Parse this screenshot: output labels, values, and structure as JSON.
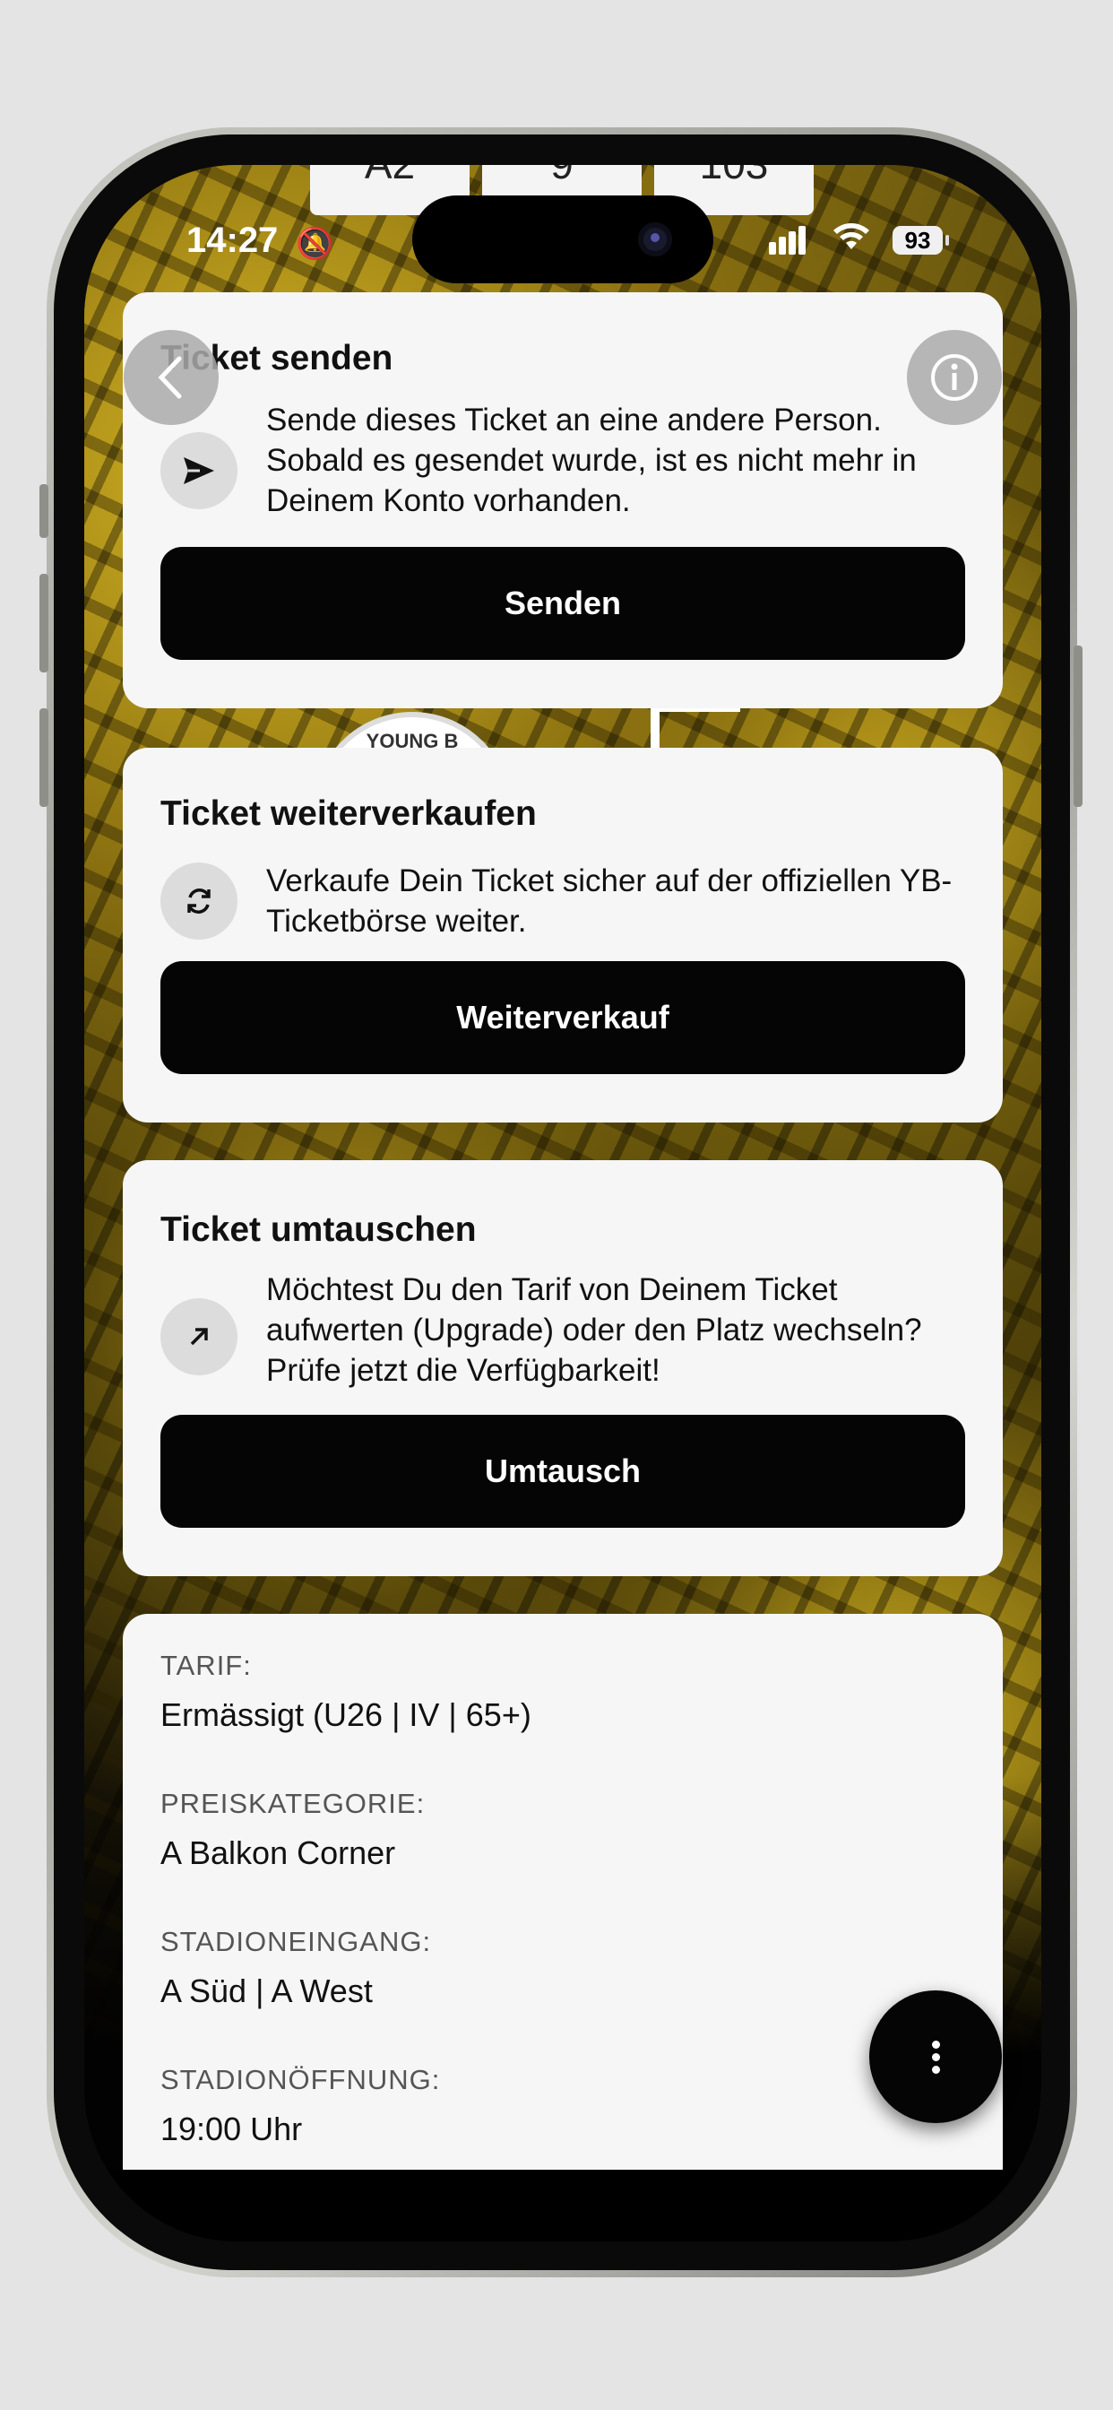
{
  "status_bar": {
    "time": "14:27",
    "battery": "93"
  },
  "seat_tabs": [
    "A2",
    "9",
    "103"
  ],
  "send_card": {
    "title": "Ticket senden",
    "description": "Sende dieses Ticket an eine andere Person. Sobald es gesendet wurde, ist es nicht mehr in Deinem Konto vorhanden.",
    "button": "Senden",
    "icon": "send-icon"
  },
  "resell_card": {
    "title": "Ticket weiterverkaufen",
    "description": "Verkaufe Dein Ticket sicher auf der offiziellen YB-Ticketbörse weiter.",
    "button": "Weiterverkauf",
    "icon": "refresh-icon"
  },
  "exchange_card": {
    "title": "Ticket umtauschen",
    "description": "Möchtest Du den Tarif von Deinem Ticket aufwerten (Upgrade) oder den Platz wechseln? Prüfe jetzt die Verfügbarkeit!",
    "button": "Umtausch",
    "icon": "arrow-up-right-icon"
  },
  "logo_peek": "YOUNG B",
  "details": [
    {
      "label": "TARIF:",
      "value": "Ermässigt (U26 | IV | 65+)"
    },
    {
      "label": "PREISKATEGORIE:",
      "value": "A Balkon Corner"
    },
    {
      "label": "STADIONEINGANG:",
      "value": "A Süd | A West"
    },
    {
      "label": "STADIONÖFFNUNG:",
      "value": "19:00 Uhr"
    }
  ],
  "colors": {
    "card_bg": "#f6f6f6",
    "button_bg": "#050505",
    "accent_yellow": "#d9b824"
  }
}
